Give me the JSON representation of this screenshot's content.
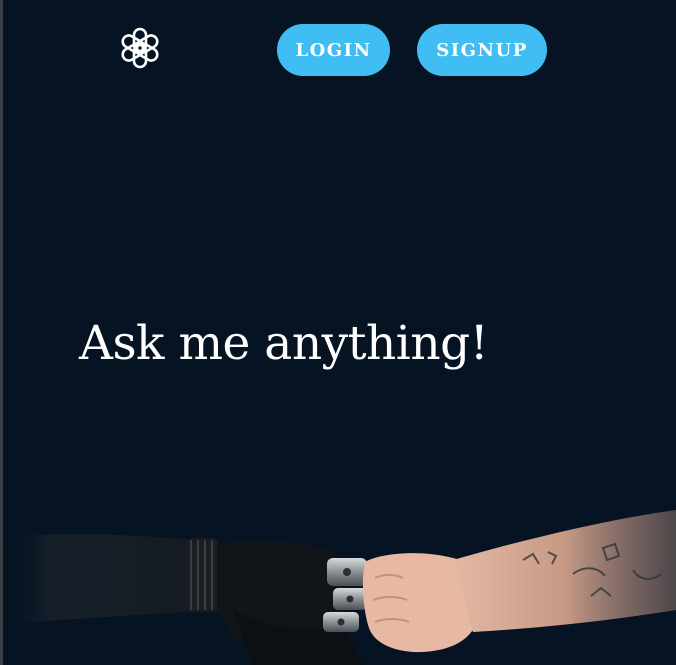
{
  "header": {
    "logo_icon": "openai-logo-icon",
    "login_label": "LOGIN",
    "signup_label": "SIGNUP"
  },
  "hero": {
    "headline": "Ask me anything!",
    "image_icon": "robot-human-fist-bump-image"
  },
  "colors": {
    "background": "#061322",
    "button": "#40bdf2",
    "button_text": "#ffffff",
    "headline": "#ffffff"
  }
}
